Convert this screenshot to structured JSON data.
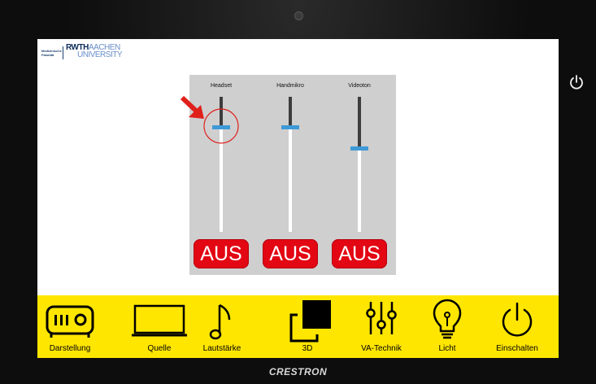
{
  "logo": {
    "small_text": "Medizinische Fakultät",
    "rwth": "RWTH",
    "aachen": "AACHEN",
    "university": "UNIVERSITY"
  },
  "audio_panel": {
    "channels": [
      {
        "label": "Headset",
        "level": 0.78,
        "mute_label": "AUS"
      },
      {
        "label": "Handmikro",
        "level": 0.78,
        "mute_label": "AUS"
      },
      {
        "label": "Videoton",
        "level": 0.62,
        "mute_label": "AUS"
      }
    ]
  },
  "nav": {
    "items": [
      {
        "label": "Darstellung",
        "icon": "projector-icon"
      },
      {
        "label": "Quelle",
        "icon": "laptop-icon"
      },
      {
        "label": "Lautstärke",
        "icon": "music-note-icon"
      },
      {
        "label": "3D",
        "icon": "3d-object-icon"
      },
      {
        "label": "VA-Technik",
        "icon": "mixer-sliders-icon"
      },
      {
        "label": "Licht",
        "icon": "light-bulb-icon"
      },
      {
        "label": "Einschalten",
        "icon": "power-icon"
      }
    ]
  },
  "brand": "CRESTRON",
  "colors": {
    "nav_bar": "#ffe600",
    "mute_button": "#e30613",
    "slider_thumb": "#3d9ad7",
    "panel": "#cfcfcf",
    "annotation": "#e0201b"
  }
}
